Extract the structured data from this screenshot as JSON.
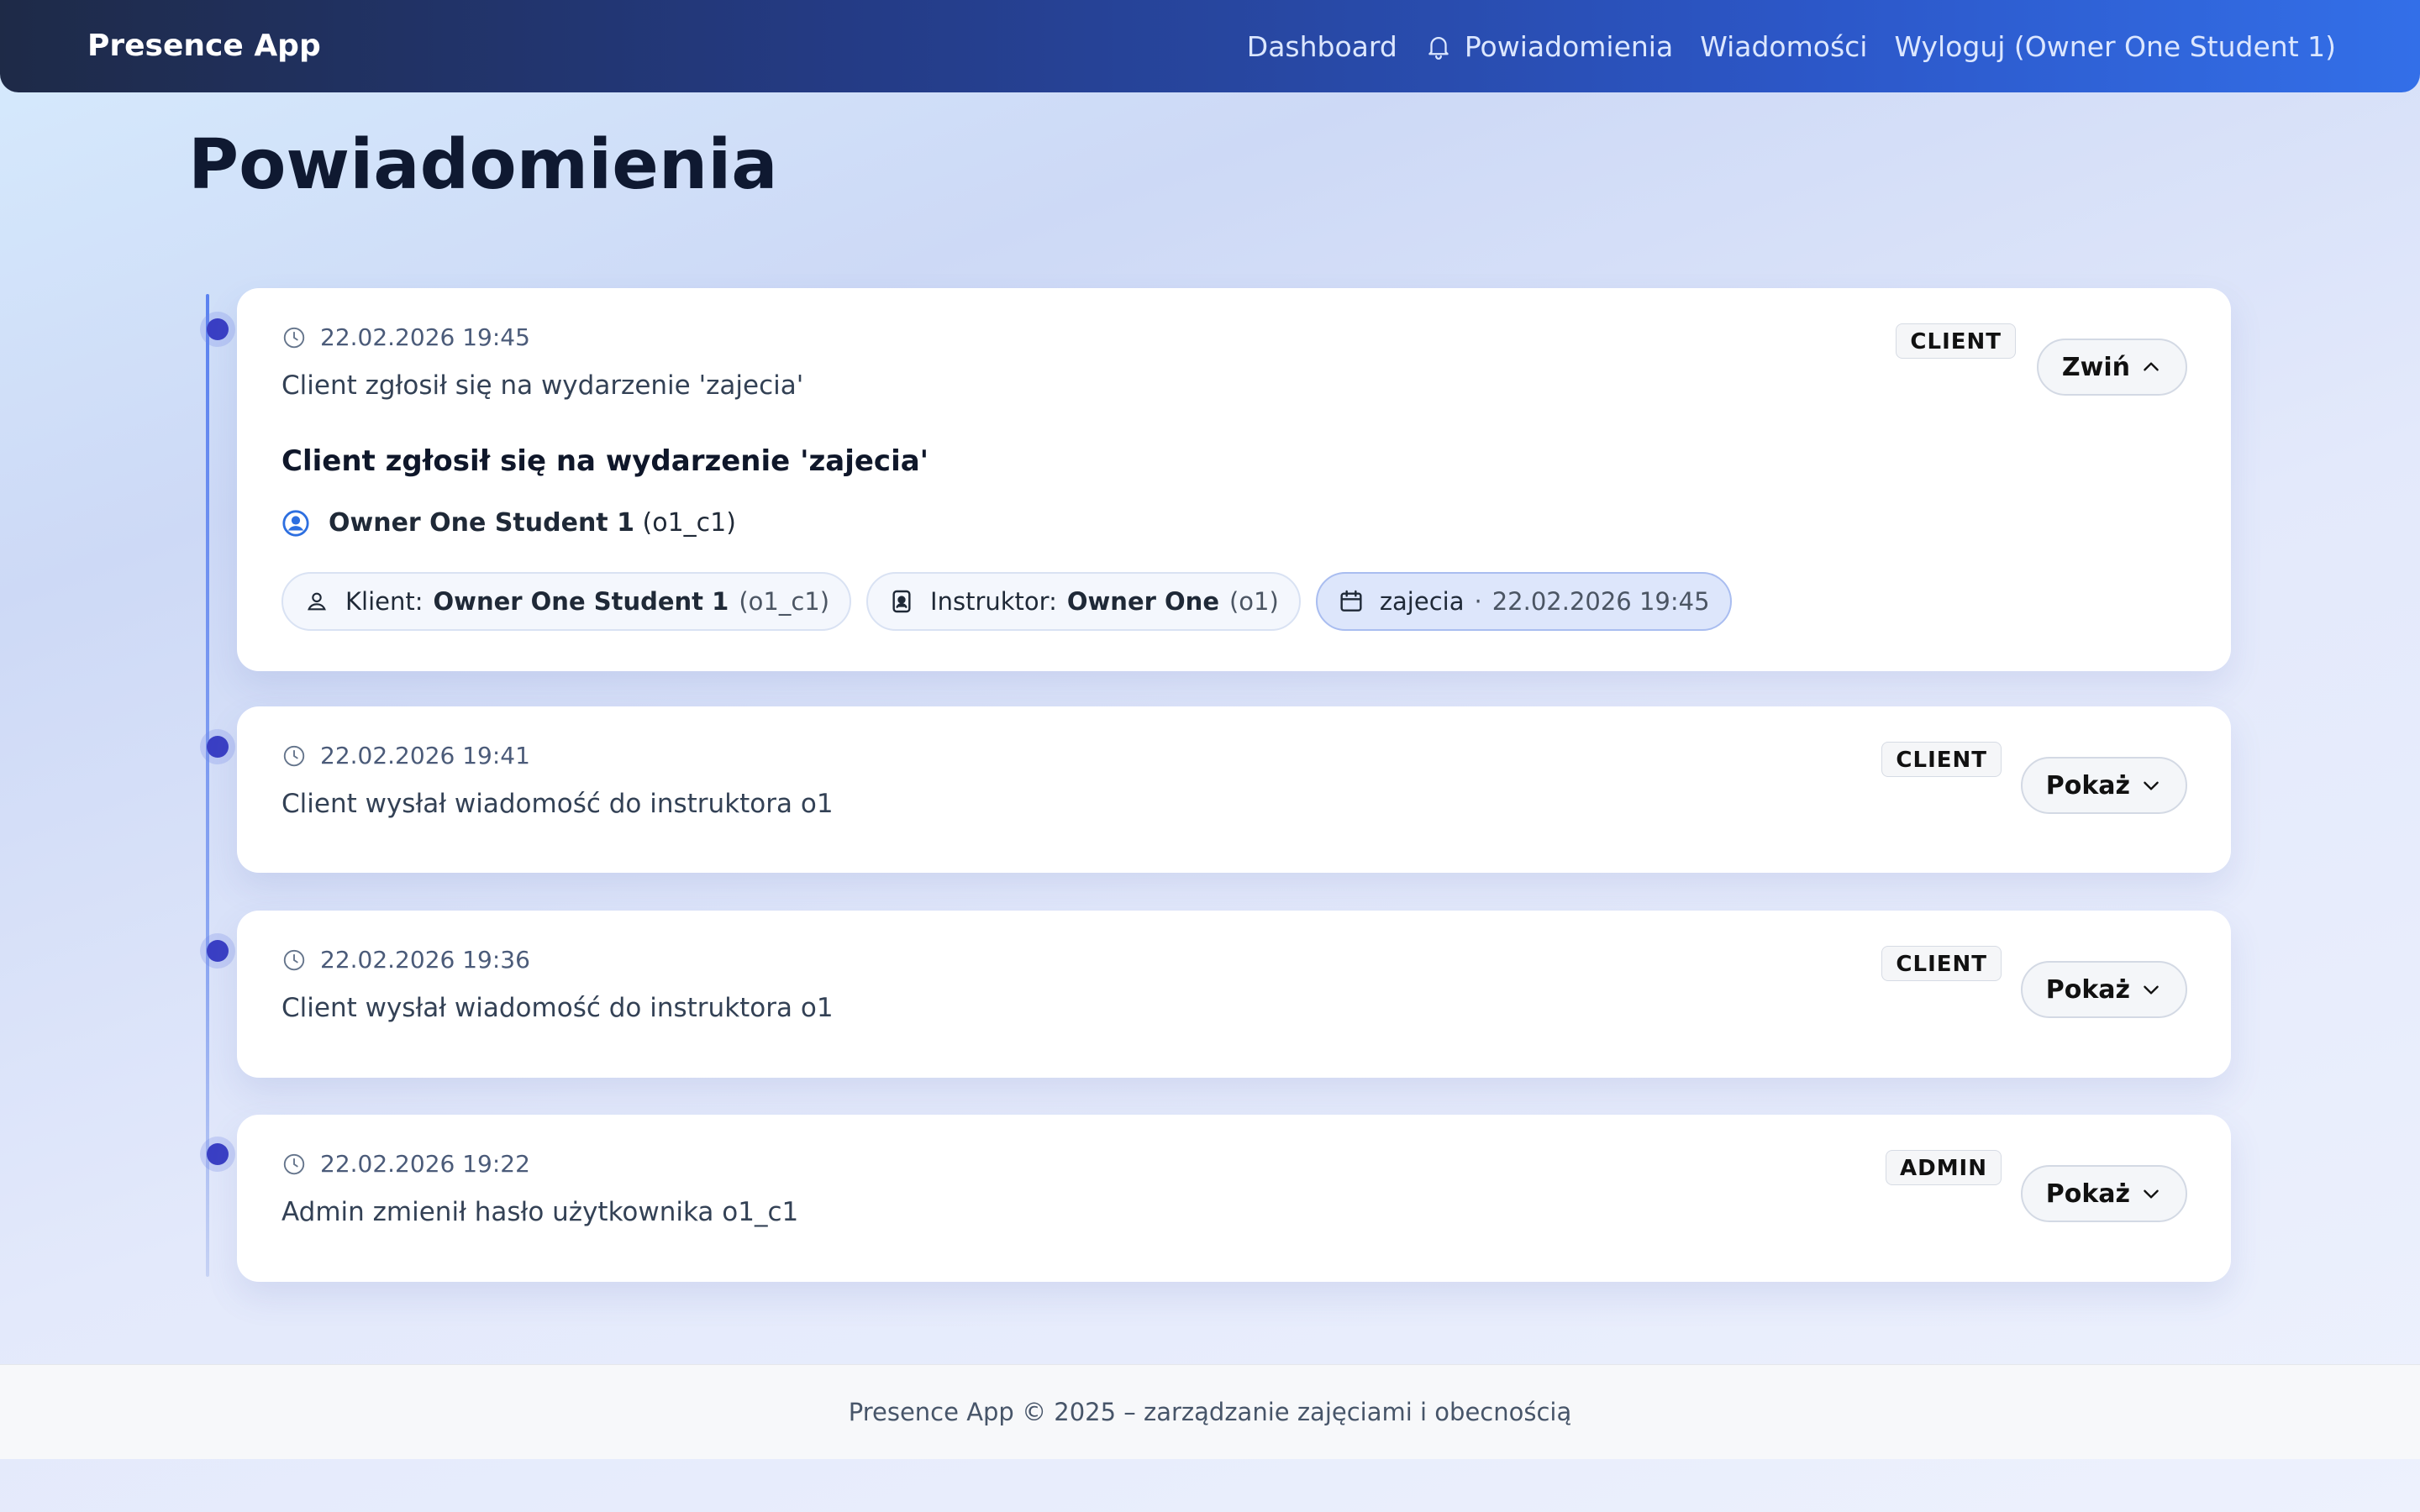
{
  "app": {
    "brand": "Presence App"
  },
  "nav": {
    "dashboard": "Dashboard",
    "notifications": "Powiadomienia",
    "messages": "Wiadomości",
    "logout": "Wyloguj (Owner One Student 1)"
  },
  "page": {
    "title": "Powiadomienia"
  },
  "notifications": [
    {
      "time": "22.02.2026 19:45",
      "text": "Client zgłosił się na wydarzenie 'zajecia'",
      "badge": "CLIENT",
      "toggle": "Zwiń",
      "expanded": true,
      "detail": {
        "title": "Client zgłosił się na wydarzenie 'zajecia'",
        "user_name": "Owner One Student 1",
        "user_login": "(o1_c1)",
        "client_label": "Klient:",
        "client_name": "Owner One Student 1",
        "client_login": "(o1_c1)",
        "instructor_label": "Instruktor:",
        "instructor_name": "Owner One",
        "instructor_login": "(o1)",
        "event_name": "zajecia",
        "event_sep": "·",
        "event_date": "22.02.2026 19:45"
      }
    },
    {
      "time": "22.02.2026 19:41",
      "text": "Client wysłał wiadomość do instruktora o1",
      "badge": "CLIENT",
      "toggle": "Pokaż",
      "expanded": false
    },
    {
      "time": "22.02.2026 19:36",
      "text": "Client wysłał wiadomość do instruktora o1",
      "badge": "CLIENT",
      "toggle": "Pokaż",
      "expanded": false
    },
    {
      "time": "22.02.2026 19:22",
      "text": "Admin zmienił hasło użytkownika o1_c1",
      "badge": "ADMIN",
      "toggle": "Pokaż",
      "expanded": false
    }
  ],
  "footer": {
    "text": "Presence App © 2025 – zarządzanie zajęciami i obecnością"
  },
  "colors": {
    "accent": "#3a3fc4",
    "nav_start": "#1e2a47",
    "nav_end": "#336fe8"
  }
}
